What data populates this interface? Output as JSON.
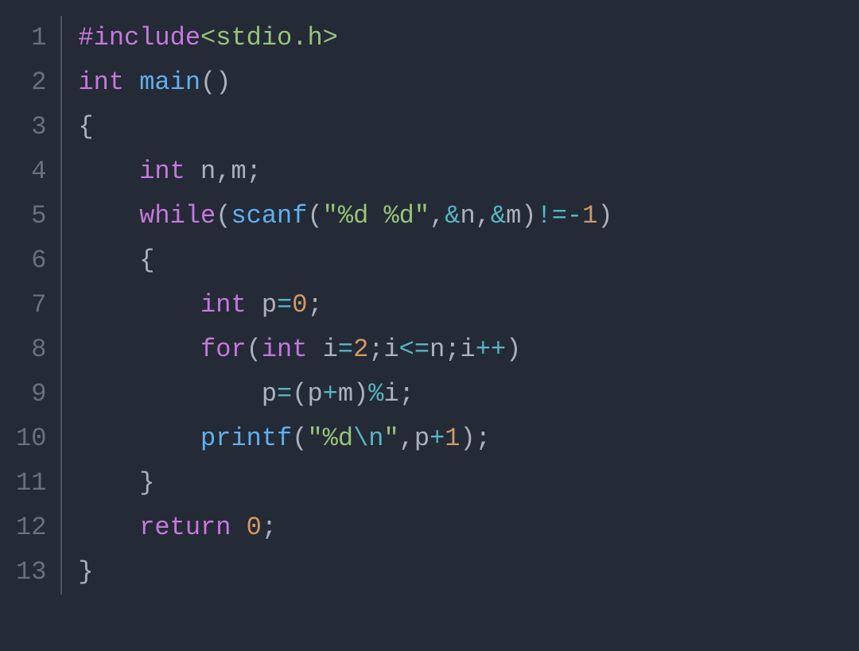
{
  "editor": {
    "line_count": 13,
    "line_numbers": [
      "1",
      "2",
      "3",
      "4",
      "5",
      "6",
      "7",
      "8",
      "9",
      "10",
      "11",
      "12",
      "13"
    ],
    "code_lines": [
      {
        "indent": "",
        "tokens": [
          {
            "t": "#include",
            "c": "tok-preproc"
          },
          {
            "t": "<stdio.h>",
            "c": "tok-header"
          }
        ],
        "plain": "#include<stdio.h>"
      },
      {
        "indent": "",
        "tokens": [
          {
            "t": "int",
            "c": "tok-type"
          },
          {
            "t": " ",
            "c": ""
          },
          {
            "t": "main",
            "c": "tok-func"
          },
          {
            "t": "()",
            "c": "tok-punct"
          }
        ],
        "plain": "int main()"
      },
      {
        "indent": "",
        "tokens": [
          {
            "t": "{",
            "c": "tok-punct"
          }
        ],
        "plain": "{"
      },
      {
        "indent": "    ",
        "tokens": [
          {
            "t": "int",
            "c": "tok-type"
          },
          {
            "t": " n",
            "c": "tok-ident"
          },
          {
            "t": ",",
            "c": "tok-punct"
          },
          {
            "t": "m",
            "c": "tok-ident"
          },
          {
            "t": ";",
            "c": "tok-punct"
          }
        ],
        "plain": "    int n,m;"
      },
      {
        "indent": "    ",
        "tokens": [
          {
            "t": "while",
            "c": "tok-keyword"
          },
          {
            "t": "(",
            "c": "tok-punct"
          },
          {
            "t": "scanf",
            "c": "tok-func"
          },
          {
            "t": "(",
            "c": "tok-punct"
          },
          {
            "t": "\"%d %d\"",
            "c": "tok-string"
          },
          {
            "t": ",",
            "c": "tok-punct"
          },
          {
            "t": "&",
            "c": "tok-amp"
          },
          {
            "t": "n",
            "c": "tok-ident"
          },
          {
            "t": ",",
            "c": "tok-punct"
          },
          {
            "t": "&",
            "c": "tok-amp"
          },
          {
            "t": "m",
            "c": "tok-ident"
          },
          {
            "t": ")",
            "c": "tok-punct"
          },
          {
            "t": "!=",
            "c": "tok-operator"
          },
          {
            "t": "-",
            "c": "tok-operator"
          },
          {
            "t": "1",
            "c": "tok-number"
          },
          {
            "t": ")",
            "c": "tok-punct"
          }
        ],
        "plain": "    while(scanf(\"%d %d\",&n,&m)!=-1)"
      },
      {
        "indent": "    ",
        "tokens": [
          {
            "t": "{",
            "c": "tok-punct"
          }
        ],
        "plain": "    {"
      },
      {
        "indent": "        ",
        "tokens": [
          {
            "t": "int",
            "c": "tok-type"
          },
          {
            "t": " p",
            "c": "tok-ident"
          },
          {
            "t": "=",
            "c": "tok-operator"
          },
          {
            "t": "0",
            "c": "tok-number"
          },
          {
            "t": ";",
            "c": "tok-punct"
          }
        ],
        "plain": "        int p=0;"
      },
      {
        "indent": "        ",
        "tokens": [
          {
            "t": "for",
            "c": "tok-keyword"
          },
          {
            "t": "(",
            "c": "tok-punct"
          },
          {
            "t": "int",
            "c": "tok-type"
          },
          {
            "t": " i",
            "c": "tok-ident"
          },
          {
            "t": "=",
            "c": "tok-operator"
          },
          {
            "t": "2",
            "c": "tok-number"
          },
          {
            "t": ";",
            "c": "tok-punct"
          },
          {
            "t": "i",
            "c": "tok-ident"
          },
          {
            "t": "<=",
            "c": "tok-operator"
          },
          {
            "t": "n",
            "c": "tok-ident"
          },
          {
            "t": ";",
            "c": "tok-punct"
          },
          {
            "t": "i",
            "c": "tok-ident"
          },
          {
            "t": "++",
            "c": "tok-operator"
          },
          {
            "t": ")",
            "c": "tok-punct"
          }
        ],
        "plain": "        for(int i=2;i<=n;i++)"
      },
      {
        "indent": "            ",
        "tokens": [
          {
            "t": "p",
            "c": "tok-ident"
          },
          {
            "t": "=",
            "c": "tok-operator"
          },
          {
            "t": "(",
            "c": "tok-punct"
          },
          {
            "t": "p",
            "c": "tok-ident"
          },
          {
            "t": "+",
            "c": "tok-operator"
          },
          {
            "t": "m",
            "c": "tok-ident"
          },
          {
            "t": ")",
            "c": "tok-punct"
          },
          {
            "t": "%",
            "c": "tok-operator"
          },
          {
            "t": "i",
            "c": "tok-ident"
          },
          {
            "t": ";",
            "c": "tok-punct"
          }
        ],
        "plain": "            p=(p+m)%i;"
      },
      {
        "indent": "        ",
        "tokens": [
          {
            "t": "printf",
            "c": "tok-func"
          },
          {
            "t": "(",
            "c": "tok-punct"
          },
          {
            "t": "\"%d",
            "c": "tok-string"
          },
          {
            "t": "\\n",
            "c": "tok-escape"
          },
          {
            "t": "\"",
            "c": "tok-string"
          },
          {
            "t": ",",
            "c": "tok-punct"
          },
          {
            "t": "p",
            "c": "tok-ident"
          },
          {
            "t": "+",
            "c": "tok-operator"
          },
          {
            "t": "1",
            "c": "tok-number"
          },
          {
            "t": ")",
            "c": "tok-punct"
          },
          {
            "t": ";",
            "c": "tok-punct"
          }
        ],
        "plain": "        printf(\"%d\\n\",p+1);"
      },
      {
        "indent": "    ",
        "tokens": [
          {
            "t": "}",
            "c": "tok-punct"
          }
        ],
        "plain": "    }"
      },
      {
        "indent": "    ",
        "tokens": [
          {
            "t": "return",
            "c": "tok-keyword"
          },
          {
            "t": " ",
            "c": ""
          },
          {
            "t": "0",
            "c": "tok-number"
          },
          {
            "t": ";",
            "c": "tok-punct"
          }
        ],
        "plain": "    return 0;"
      },
      {
        "indent": "",
        "tokens": [
          {
            "t": "}",
            "c": "tok-punct"
          }
        ],
        "plain": "}"
      }
    ]
  }
}
